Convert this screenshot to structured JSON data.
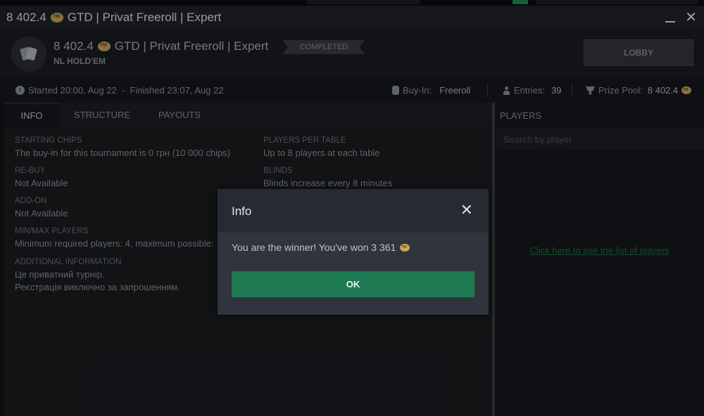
{
  "window": {
    "title_amount": "8 402.4",
    "title_text": "GTD | Privat Freeroll | Expert",
    "close_glyph": "✕"
  },
  "header": {
    "amount": "8 402.4",
    "name": "GTD | Privat Freeroll | Expert",
    "game": "NL HOLD'EM",
    "status": "COMPLETED",
    "lobby_label": "LOBBY"
  },
  "infobar": {
    "times": "Started 20:00, Aug 22  -  Finished 23:07, Aug 22",
    "buyin_label": "Buy-In:",
    "buyin_value": "Freeroll",
    "entries_label": "Entries:",
    "entries_value": "39",
    "prize_label": "Prize Pool:",
    "prize_value": "8 402.4"
  },
  "tabs": [
    {
      "label": "INFO",
      "active": true
    },
    {
      "label": "STRUCTURE",
      "active": false
    },
    {
      "label": "PAYOUTS",
      "active": false
    }
  ],
  "info": {
    "starting_chips": {
      "label": "STARTING CHIPS",
      "value": "The buy-in for this tournament is 0 грн (10 000 chips)"
    },
    "rebuy": {
      "label": "RE-BUY",
      "value": "Not Available"
    },
    "addon": {
      "label": "ADD-ON",
      "value": "Not Available"
    },
    "minmax": {
      "label": "MIN/MAX PLAYERS",
      "value": "Minimum required players: 4, maximum possible:"
    },
    "additional": {
      "label": "ADDITIONAL INFORMATION",
      "line1": "Це приватний турнір.",
      "line2": "Реєстрація виключно за запрошенням."
    },
    "per_table": {
      "label": "PLAYERS PER TABLE",
      "value": "Up to 8 players at each table"
    },
    "blinds": {
      "label": "BLINDS",
      "value": "Blinds increase every 8 minutes"
    }
  },
  "players": {
    "heading": "PLAYERS",
    "search_placeholder": "Search by player",
    "link": "Click here to see the list of players"
  },
  "modal": {
    "title": "Info",
    "close_glyph": "✕",
    "message": "You are the winner! You've won 3 361",
    "ok_label": "OK"
  },
  "colors": {
    "accent_green": "#1d7a52",
    "background": "#16181c"
  }
}
